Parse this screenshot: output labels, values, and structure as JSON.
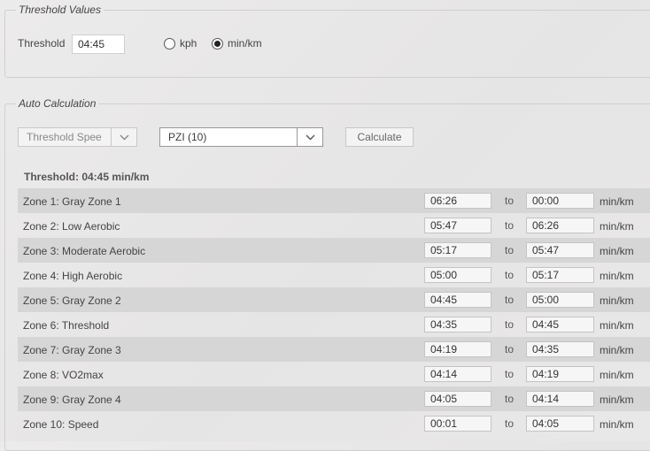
{
  "threshold_values": {
    "legend": "Threshold Values",
    "threshold_label": "Threshold",
    "threshold_value": "04:45",
    "units": [
      {
        "label": "kph",
        "selected": false
      },
      {
        "label": "min/km",
        "selected": true
      }
    ]
  },
  "auto_calculation": {
    "legend": "Auto Calculation",
    "method_select": "Threshold Spee",
    "zone_model_select": "PZI (10)",
    "calculate_label": "Calculate",
    "summary": "Threshold: 04:45 min/km",
    "to_label": "to",
    "unit_label": "min/km",
    "zones": [
      {
        "name": "Zone 1: Gray Zone 1",
        "from": "06:26",
        "to": "00:00"
      },
      {
        "name": "Zone 2: Low Aerobic",
        "from": "05:47",
        "to": "06:26"
      },
      {
        "name": "Zone 3: Moderate Aerobic",
        "from": "05:17",
        "to": "05:47"
      },
      {
        "name": "Zone 4: High Aerobic",
        "from": "05:00",
        "to": "05:17"
      },
      {
        "name": "Zone 5: Gray Zone 2",
        "from": "04:45",
        "to": "05:00"
      },
      {
        "name": "Zone 6: Threshold",
        "from": "04:35",
        "to": "04:45"
      },
      {
        "name": "Zone 7: Gray Zone 3",
        "from": "04:19",
        "to": "04:35"
      },
      {
        "name": "Zone 8: VO2max",
        "from": "04:14",
        "to": "04:19"
      },
      {
        "name": "Zone 9: Gray Zone 4",
        "from": "04:05",
        "to": "04:14"
      },
      {
        "name": "Zone 10: Speed",
        "from": "00:01",
        "to": "04:05"
      }
    ]
  }
}
